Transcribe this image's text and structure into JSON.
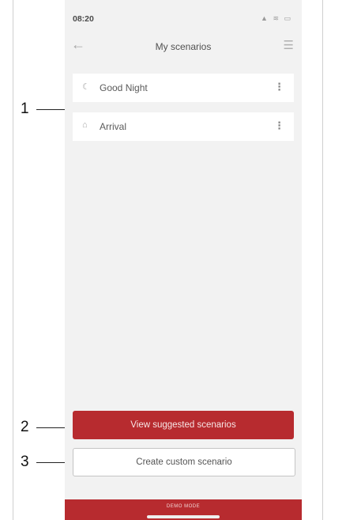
{
  "callouts": [
    "1",
    "2",
    "3"
  ],
  "status_bar": {
    "time": "08:20",
    "icons": "▲ ≋ ▭"
  },
  "app_bar": {
    "title": "My scenarios",
    "back_icon": "arrow-left-icon",
    "menu_icon": "hamburger-menu-icon"
  },
  "scenarios": [
    {
      "label": "Good Night",
      "icon": "moon-cloud-icon"
    },
    {
      "label": "Arrival",
      "icon": "building-icon"
    }
  ],
  "buttons": {
    "view_suggested": "View suggested scenarios",
    "create_custom": "Create custom scenario"
  },
  "demo_mode": {
    "label": "DEMO MODE"
  },
  "colors": {
    "accent": "#b72b2f",
    "background": "#f2f2f2",
    "card": "#ffffff"
  }
}
